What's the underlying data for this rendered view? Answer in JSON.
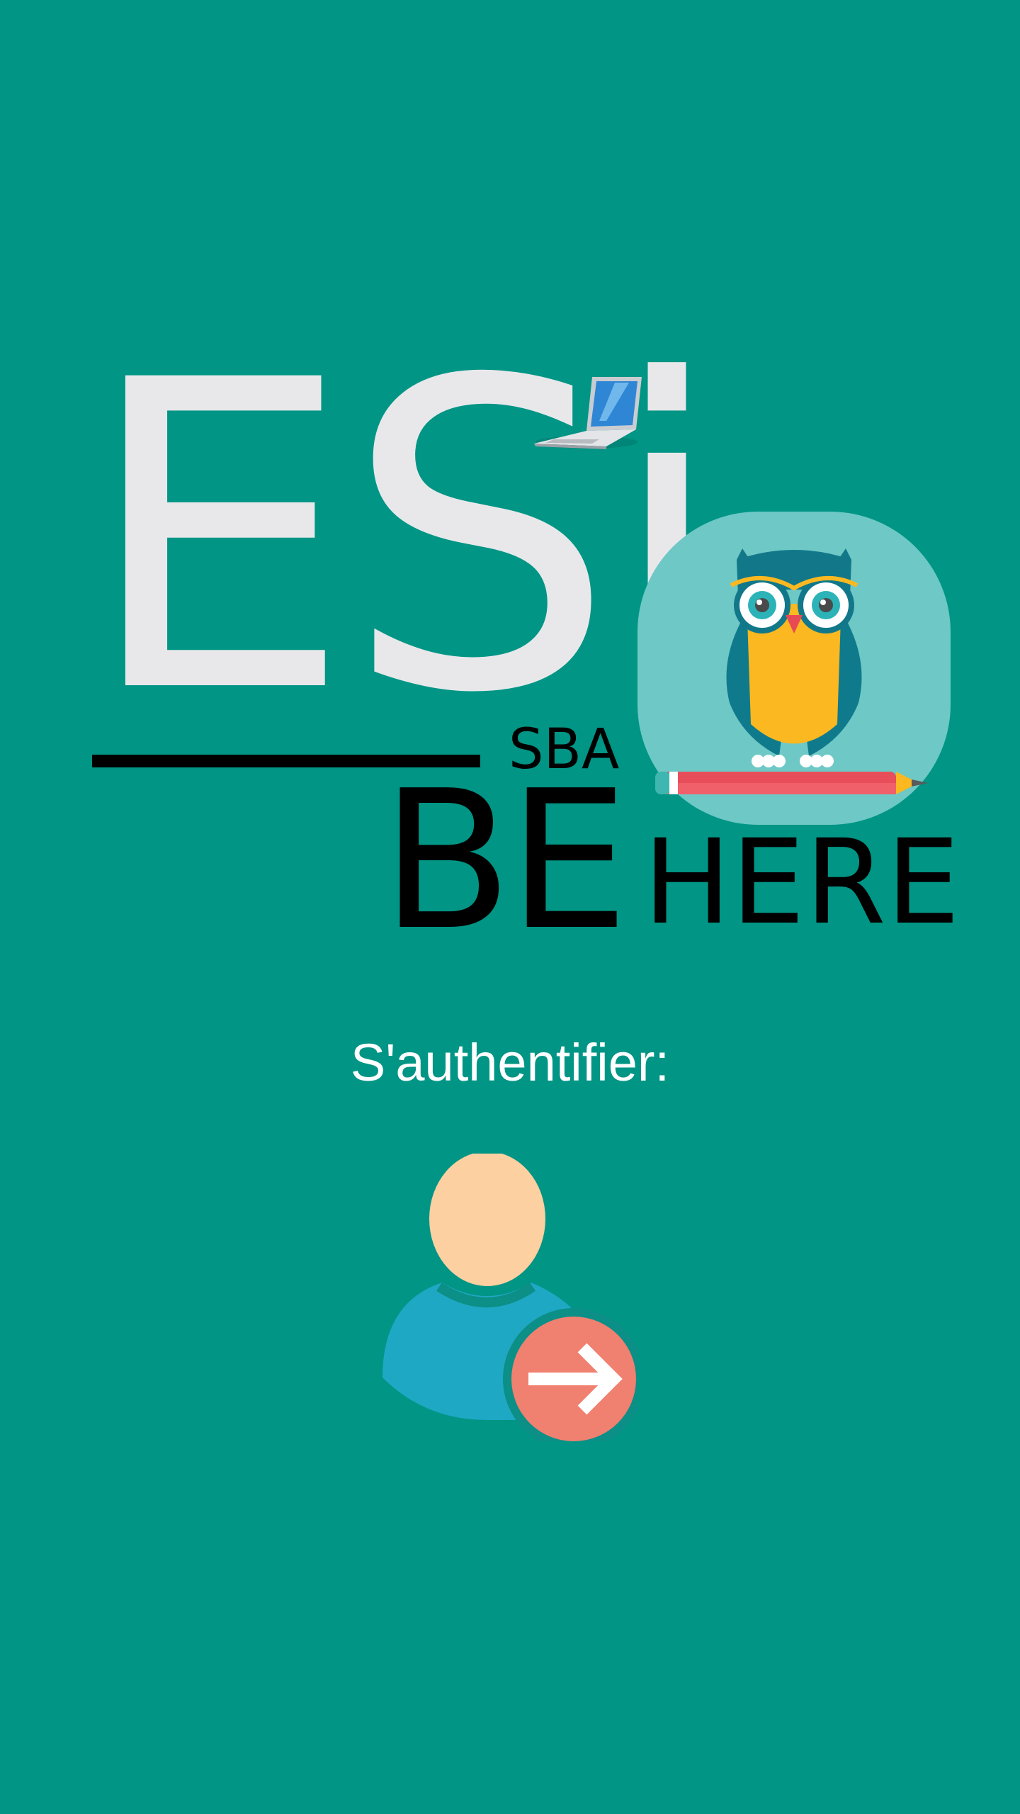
{
  "logo": {
    "title": "ESi",
    "subtitle": "SBA",
    "tagline_big": "BE",
    "tagline_small": "HERE"
  },
  "auth": {
    "label": "S'authentifier:"
  },
  "icons": {
    "laptop": "laptop-icon",
    "owl": "owl-icon",
    "pencil": "pencil-icon",
    "user": "user-icon",
    "arrow": "arrow-right-icon"
  },
  "colors": {
    "background": "#009585",
    "logo_text": "#e8e8ea",
    "owl_tile": "#6ec8c6",
    "owl_body": "#fbb820",
    "user_head": "#fcd0a1",
    "user_body": "#1fa8c4",
    "arrow_badge": "#f08070"
  }
}
